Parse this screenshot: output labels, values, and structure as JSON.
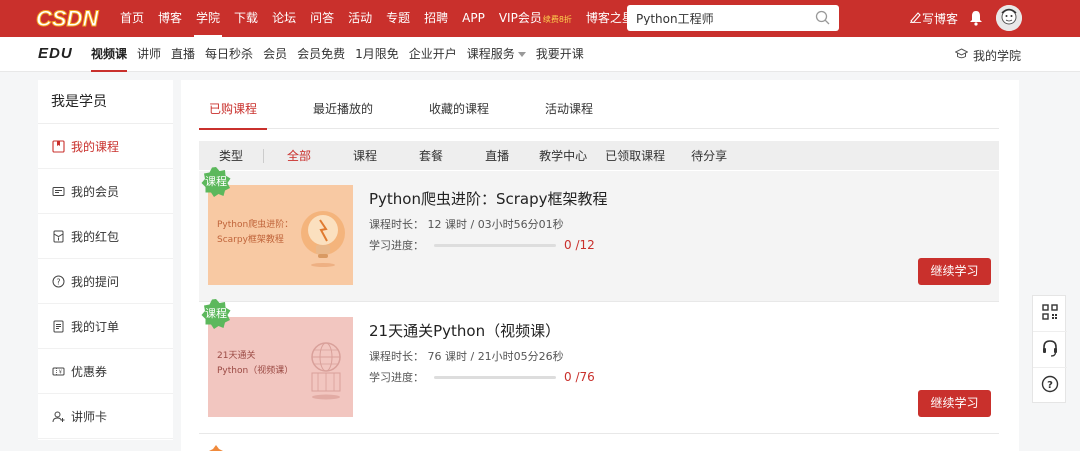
{
  "topbar": {
    "logo": "CSDN",
    "nav": [
      "首页",
      "博客",
      "学院",
      "下载",
      "论坛",
      "问答",
      "活动",
      "专题",
      "招聘",
      "APP"
    ],
    "active_index": 2,
    "vip_label": "VIP会员",
    "vip_badge": "续费8折",
    "star_label": "博客之星",
    "search_value": "Python工程师",
    "write_label": "写博客",
    "brand_color": "#c9302c"
  },
  "subnav": {
    "logo": "EDU",
    "items": [
      "视频课",
      "讲师",
      "直播",
      "每日秒杀",
      "会员",
      "会员免费",
      "1月限免",
      "企业开户",
      "课程服务",
      "我要开课"
    ],
    "active_index": 0,
    "my_school": "我的学院"
  },
  "sidebar": {
    "title": "我是学员",
    "items": [
      {
        "label": "我的课程",
        "icon": "course-icon"
      },
      {
        "label": "我的会员",
        "icon": "member-card-icon"
      },
      {
        "label": "我的红包",
        "icon": "red-envelope-icon"
      },
      {
        "label": "我的提问",
        "icon": "question-icon"
      },
      {
        "label": "我的订单",
        "icon": "order-icon"
      },
      {
        "label": "优惠券",
        "icon": "coupon-icon"
      },
      {
        "label": "讲师卡",
        "icon": "lecturer-card-icon"
      }
    ]
  },
  "tabs": [
    "已购课程",
    "最近播放的",
    "收藏的课程",
    "活动课程"
  ],
  "filter": {
    "label": "类型",
    "items": [
      "全部",
      "课程",
      "套餐",
      "直播",
      "教学中心",
      "已领取课程",
      "待分享"
    ]
  },
  "courses": [
    {
      "badge": "课程",
      "thumb_line1": "Python爬虫进阶：",
      "thumb_line2": "Scarpy框架教程",
      "title": "Python爬虫进阶：Scrapy框架教程",
      "meta": "课程时长： 12 课时 / 03小时56分01秒",
      "progress_label": "学习进度：",
      "progress_value": "0 /12",
      "progress_fraction": 0,
      "button": "继续学习",
      "thumb_bg": "#f8c9a3",
      "thumb_text_color": "#c0643a"
    },
    {
      "badge": "课程",
      "thumb_line1": "21天通关",
      "thumb_line2": "Python（视频课）",
      "title": "21天通关Python（视频课）",
      "meta": "课程时长： 76 课时 / 21小时05分26秒",
      "progress_label": "学习进度：",
      "progress_value": "0 /76",
      "progress_fraction": 0,
      "button": "继续学习",
      "thumb_bg": "#f2c6c0",
      "thumb_text_color": "#9b4a44"
    }
  ],
  "float_panel": [
    "qrcode-icon",
    "headset-icon",
    "help-icon"
  ]
}
